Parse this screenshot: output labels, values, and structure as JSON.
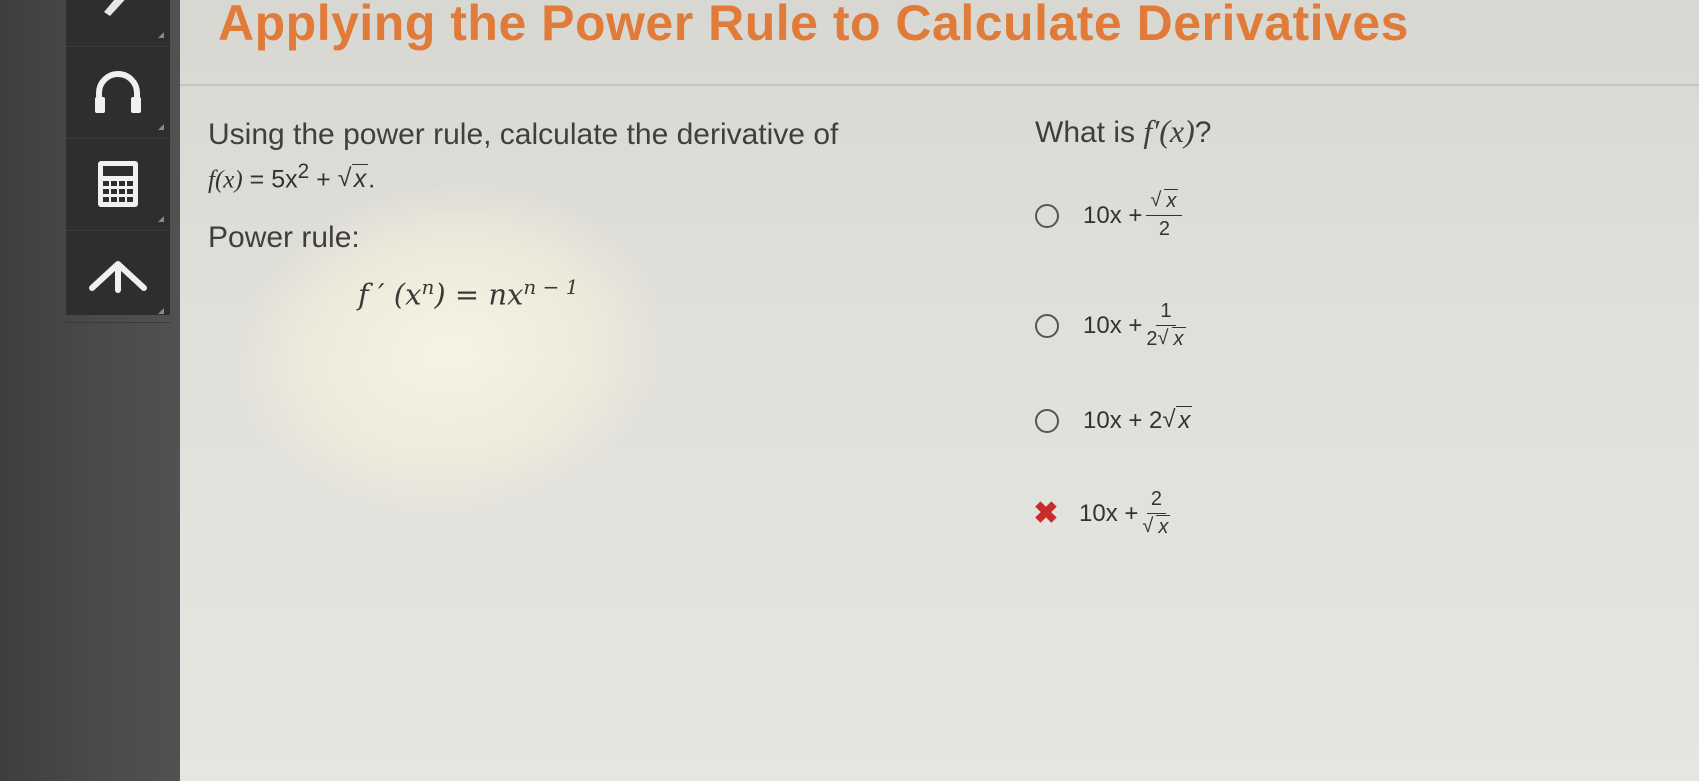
{
  "title": "Applying the Power Rule to Calculate Derivatives",
  "toolbar": {
    "tools": [
      "pencil-icon",
      "headphones-icon",
      "calculator-icon",
      "up-arrow-icon"
    ]
  },
  "problem": {
    "prompt": "Using the power rule, calculate the derivative of",
    "function": {
      "lhs": "f(x)",
      "eq": "=",
      "a": "5x",
      "a_exp": "2",
      "plus": "+",
      "rad": "x",
      "end": "."
    },
    "power_rule_label": "Power rule:",
    "power_rule": {
      "lhs": "f ′ (x",
      "lhs_exp": "n",
      "mid": ") = nx",
      "rhs_exp": "n − 1"
    }
  },
  "question": {
    "prefix": "What is ",
    "fprime": "f′(x)",
    "suffix": "?"
  },
  "options": [
    {
      "lead": "10x +",
      "num_sqrt": "x",
      "den": "2",
      "state": "unselected"
    },
    {
      "lead": "10x +",
      "num": "1",
      "den_coef": "2",
      "den_sqrt": "x",
      "state": "unselected"
    },
    {
      "lead": "10x + 2",
      "sqrt": "x",
      "state": "unselected"
    },
    {
      "lead": "10x +",
      "num": "2",
      "den_sqrt": "x",
      "state": "incorrect"
    }
  ],
  "colors": {
    "accent": "#e07b3a",
    "incorrect": "#c92a2a",
    "rail": "#2e2e30"
  }
}
